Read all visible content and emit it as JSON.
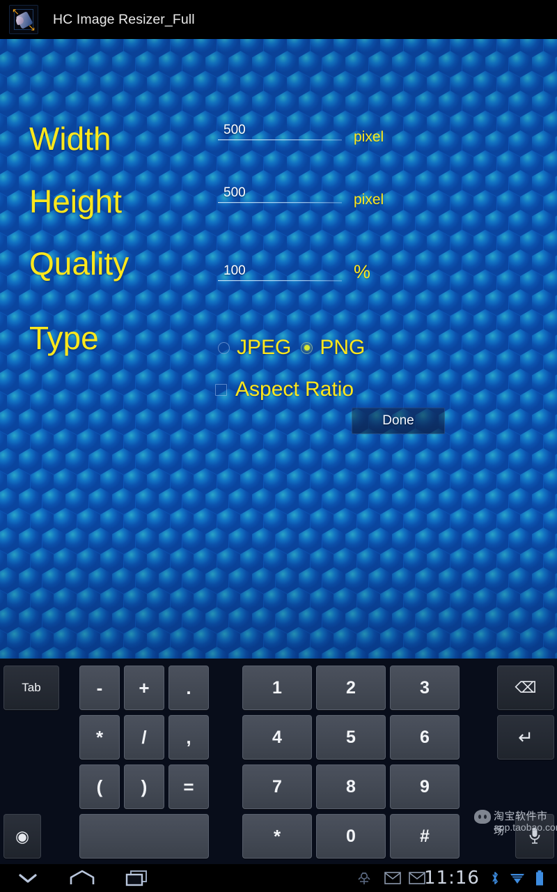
{
  "titlebar": {
    "app_title": "HC Image Resizer_Full",
    "icon_name": "app-icon-image-resizer",
    "arrow_glyph_tl": "↖",
    "arrow_glyph_br": "↘"
  },
  "form": {
    "fields": [
      {
        "label": "Width",
        "value": "500",
        "unit": "pixel"
      },
      {
        "label": "Height",
        "value": "500",
        "unit": "pixel"
      },
      {
        "label": "Quality",
        "value": "100",
        "unit": "%"
      }
    ],
    "type_label": "Type",
    "type_options": [
      {
        "label": "JPEG",
        "selected": false
      },
      {
        "label": "PNG",
        "selected": true
      }
    ],
    "aspect_ratio": {
      "label": "Aspect Ratio",
      "checked": false
    },
    "done_label": "Done"
  },
  "keyboard": {
    "tab_label": "Tab",
    "backspace_glyph": "⌫",
    "enter_glyph": "↵",
    "settings_glyph": "◉",
    "mic_glyph": "Ἲ4",
    "space_label": "",
    "keys": {
      "minus": "-",
      "plus": "+",
      "dot": ".",
      "star": "*",
      "slash": "/",
      "comma": ",",
      "lparen": "(",
      "rparen": ")",
      "equals": "=",
      "n1": "1",
      "n2": "2",
      "n3": "3",
      "n4": "4",
      "n5": "5",
      "n6": "6",
      "n7": "7",
      "n8": "8",
      "n9": "9",
      "asterisk": "*",
      "n0": "0",
      "hash": "#"
    }
  },
  "watermark": {
    "line1": "淘宝软件市场",
    "line2": "app.taobao.com"
  },
  "sysbar": {
    "back_glyph": "∨",
    "home_glyph": "⌂",
    "recents_glyph": "▭",
    "time": "11:16",
    "usb_icon": "usb-debug-icon",
    "mail1_icon": "gmail-icon",
    "mail2_icon": "gmail-icon",
    "bluetooth_glyph": "ᛦ",
    "wifi_icon": "wifi-icon",
    "battery_icon": "battery-icon"
  },
  "colors": {
    "accent_yellow": "#ffe81c",
    "background_blue": "#0d57b8",
    "hex_highlight": "#2aa6c8",
    "radio_selected": "#d6e832",
    "status_blue": "#3d8ce0"
  }
}
